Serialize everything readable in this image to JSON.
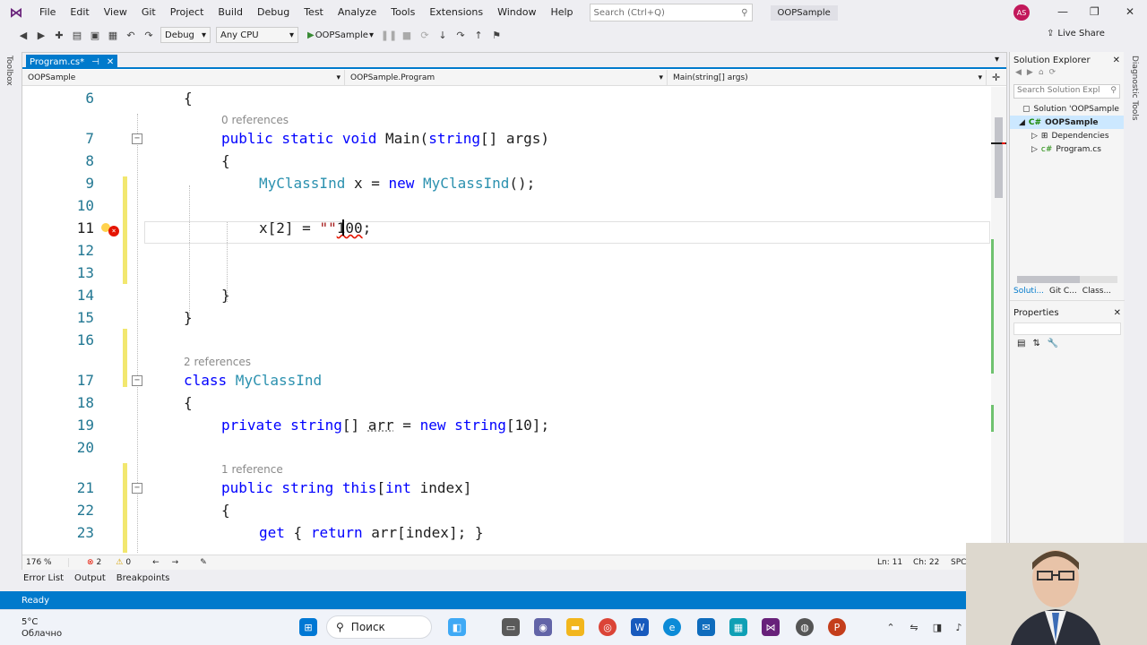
{
  "menubar": {
    "items": [
      "File",
      "Edit",
      "View",
      "Git",
      "Project",
      "Build",
      "Debug",
      "Test",
      "Analyze",
      "Tools",
      "Extensions",
      "Window",
      "Help"
    ],
    "search_placeholder": "Search (Ctrl+Q)",
    "solution_title": "OOPSample",
    "avatar_initials": "AS"
  },
  "toolbar": {
    "config": "Debug",
    "platform": "Any CPU",
    "run_target": "OOPSample",
    "live_share": "Live Share"
  },
  "left_strip": {
    "label": "Toolbox"
  },
  "right_strip": {
    "label": "Diagnostic Tools"
  },
  "editor": {
    "tab": "Program.cs*",
    "nav": {
      "project": "OOPSample",
      "type": "OOPSample.Program",
      "member": "Main(string[] args)"
    },
    "codelens": {
      "main_refs": "0 references",
      "class_refs": "2 references",
      "indexer_refs": "1 reference"
    },
    "lines": [
      {
        "n": "6",
        "text": "{"
      },
      {
        "n": "7",
        "kw1": "public static void",
        "rest": " Main(",
        "kw2": "string",
        "rest2": "[] args)"
      },
      {
        "n": "8",
        "text": "{"
      },
      {
        "n": "9",
        "ty1": "MyClassInd",
        "mid": " x = ",
        "kw": "new",
        "ty2": " MyClassInd",
        "end": "();"
      },
      {
        "n": "10",
        "text": ""
      },
      {
        "n": "11",
        "pre": "x[2] = ",
        "str": "\"\"",
        "err": "100",
        "end": ";"
      },
      {
        "n": "12",
        "text": ""
      },
      {
        "n": "13",
        "text": ""
      },
      {
        "n": "14",
        "text": "}"
      },
      {
        "n": "15",
        "text": "}"
      },
      {
        "n": "16",
        "text": ""
      },
      {
        "n": "17",
        "kw": "class",
        "ty": " MyClassInd"
      },
      {
        "n": "18",
        "text": "{"
      },
      {
        "n": "19",
        "kw1": "private string",
        "rest": "[] ",
        "squig": "arr",
        "mid": " = ",
        "kw2": "new string",
        "end": "[10];"
      },
      {
        "n": "20",
        "text": ""
      },
      {
        "n": "21",
        "kw1": "public string this",
        "rest": "[",
        "kw2": "int",
        "end": " index]"
      },
      {
        "n": "22",
        "text": "{"
      },
      {
        "n": "23",
        "kw1": "get",
        "rest": " { ",
        "kw2": "return",
        "end": " arr[index]; }"
      }
    ],
    "status": {
      "zoom": "176 %",
      "errors": "2",
      "warnings": "0",
      "ln": "Ln: 11",
      "ch": "Ch: 22",
      "encoding": "SPC"
    }
  },
  "solution_explorer": {
    "title": "Solution Explorer",
    "search_placeholder": "Search Solution Expl",
    "items": [
      "Solution 'OOPSample",
      "OOPSample",
      "Dependencies",
      "Program.cs"
    ],
    "tabs": [
      "Soluti...",
      "Git C...",
      "Class..."
    ]
  },
  "properties": {
    "title": "Properties"
  },
  "tool_windows": [
    "Error List",
    "Output",
    "Breakpoints"
  ],
  "statusbar": {
    "text": "Ready"
  },
  "taskbar": {
    "temp": "5°C",
    "weather": "Облачно",
    "search": "Поиск"
  },
  "colors": {
    "accent": "#007acc",
    "error": "#e51400",
    "keyword": "#0000ff",
    "type": "#2b91af"
  }
}
